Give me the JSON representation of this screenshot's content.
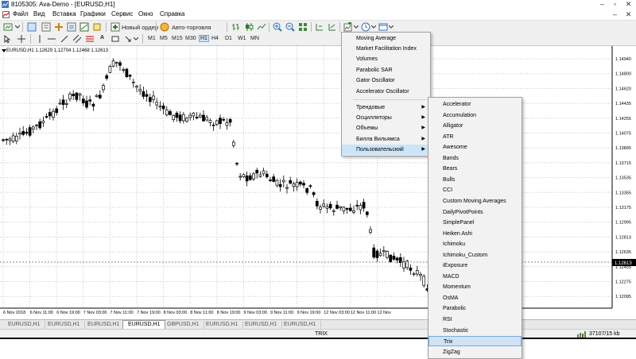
{
  "window": {
    "title": "8105305: Ava-Demo - [EURUSD,H1]"
  },
  "menubar": [
    "Файл",
    "Вид",
    "Вставка",
    "Графики",
    "Сервис",
    "Окно",
    "Справка"
  ],
  "toolbar": {
    "new_order": "Новый ордер",
    "autotrade": "Авто-торговля"
  },
  "timeframes": [
    "M1",
    "M5",
    "M15",
    "M30",
    "H1",
    "H4",
    "D1",
    "W1",
    "MN"
  ],
  "chart": {
    "info": "EURUSD,H1  1.12629 1.12704 1.12468 1.12613",
    "price_labels": [
      "1.14940",
      "1.14800",
      "1.14620",
      "1.14435",
      "1.14255",
      "1.14075",
      "1.13895",
      "1.13715",
      "1.13535",
      "1.13355",
      "1.13175",
      "1.12995",
      "1.12813",
      "1.12635",
      "1.12455",
      "1.12275",
      "1.12095"
    ],
    "current_price": "1.12613",
    "time_labels": [
      "6 Nov 2018",
      "6 Nov 11:00",
      "6 Nov 19:00",
      "7 Nov 03:00",
      "7 Nov 11:00",
      "7 Nov 19:00",
      "8 Nov 03:00",
      "8 Nov 11:00",
      "8 Nov 19:00",
      "9 Nov 03:00",
      "9 Nov 11:00",
      "9 Nov 19:00",
      "12 Nov 03:00",
      "12 Nov 11:00",
      "12 Nov"
    ]
  },
  "tabs": [
    "EURUSD,H1",
    "EURUSD,H1",
    "EURUSD,H1",
    "EURUSD,H1",
    "GBPUSD,H1",
    "EURUSD,H1",
    "EURUSD,H1",
    "EURUSD,H1"
  ],
  "status": {
    "center": "TRIX",
    "traffic": "37107/15 kb"
  },
  "indicator_menu": {
    "top": [
      "Moving Average",
      "Market Facilitation Index",
      "Volumes",
      "Parabolic SAR",
      "Gator Oscillator",
      "Accelerator Oscillator"
    ],
    "groups": [
      "Трендовые",
      "Осцилляторы",
      "Объемы",
      "Билла Вильямса",
      "Пользовательский"
    ]
  },
  "custom_menu": [
    "Accelerator",
    "Accumulation",
    "Alligator",
    "ATR",
    "Awesome",
    "Bands",
    "Bears",
    "Bulls",
    "CCI",
    "Custom Moving Averages",
    "DailyPivotPoints",
    "SimplePanel",
    "Heiken Ashi",
    "Ichimoku",
    "Ichimoku_Custom",
    "iExposure",
    "MACD",
    "Momentum",
    "OsMA",
    "Parabolic",
    "RSI",
    "Stochastic",
    "Trix",
    "ZigZag"
  ],
  "highlighted_item": "Trix",
  "colors": {
    "bull": "#ffffff",
    "bear": "#000000",
    "grid": "#c8c8c8",
    "accent": "#cce4f7"
  }
}
